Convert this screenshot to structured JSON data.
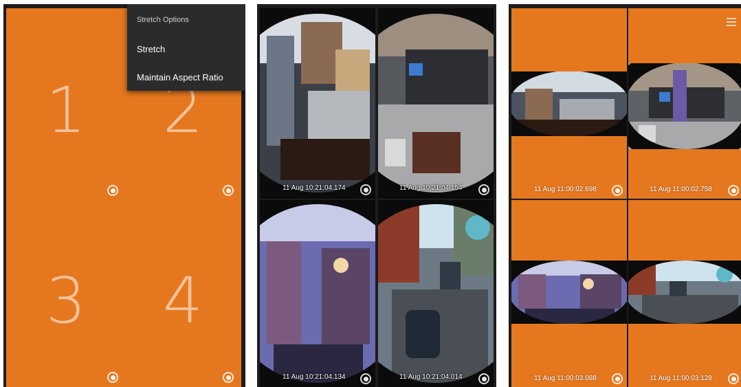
{
  "panel1": {
    "tiles": [
      {
        "number": "1"
      },
      {
        "number": "2"
      },
      {
        "number": "3"
      },
      {
        "number": "4"
      }
    ],
    "menu": {
      "header": "Stretch Options",
      "items": [
        "Stretch",
        "Maintain Aspect Ratio"
      ]
    }
  },
  "panel2": {
    "timestamps": [
      "11 Aug 10:21:04.174",
      "11 Aug 10:21:04.154",
      "11 Aug 10:21:04.134",
      "11 Aug 10:21:04.014"
    ]
  },
  "panel3": {
    "timestamps": [
      "11 Aug 11:00:02.698",
      "11 Aug 11:00:02.758",
      "11 Aug 11:00:03.088",
      "11 Aug 11:00:03.128"
    ]
  },
  "colors": {
    "tile_orange": "#e5781f",
    "frame": "#1c1c1c"
  },
  "icons": [
    "record-icon",
    "menu-icon"
  ]
}
